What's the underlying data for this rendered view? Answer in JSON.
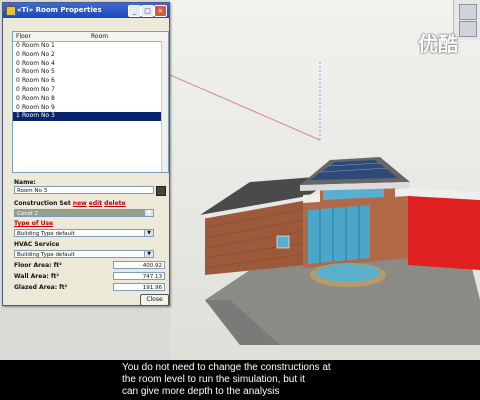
{
  "window": {
    "title": "«Ti» Room Properties"
  },
  "watermark": "优酷",
  "room_list": {
    "columns": [
      "Floor",
      "Room"
    ],
    "rows": [
      {
        "floor": "0",
        "room": "Room No 1"
      },
      {
        "floor": "0",
        "room": "Room No 2"
      },
      {
        "floor": "0",
        "room": "Room No 4"
      },
      {
        "floor": "0",
        "room": "Room No 5"
      },
      {
        "floor": "0",
        "room": "Room No 6"
      },
      {
        "floor": "0",
        "room": "Room No 7"
      },
      {
        "floor": "0",
        "room": "Room No 8"
      },
      {
        "floor": "0",
        "room": "Room No 9"
      },
      {
        "floor": "1",
        "room": "Room No 3"
      }
    ],
    "selected_index": 8
  },
  "form": {
    "name_label": "Name:",
    "name_value": "Room No 3",
    "construction_label": "Construction Set",
    "construction_links": {
      "new": "new",
      "edit": "edit",
      "delete": "delete"
    },
    "construction_value": "Const 2",
    "type_of_use_label": "Type of Use",
    "type_of_use_value": "Building Type default",
    "hvac_label": "HVAC Service",
    "hvac_value": "Building Type default",
    "floor_area_label": "Floor Area:  ft²",
    "floor_area_value": "400.92",
    "wall_area_label": "Wall Area:  ft²",
    "wall_area_value": "747.13",
    "glazed_area_label": "Glazed Area:  ft²",
    "glazed_area_value": "191.96",
    "close_label": "Close"
  },
  "caption": {
    "line1": "You do not need to change the constructions at",
    "line2": "the room level to run the simulation, but it",
    "line3": "can give more depth to the analysis"
  },
  "colors": {
    "titlebar": "#2a55c8",
    "selection": "#0a246a",
    "accent_red": "#c00000"
  }
}
